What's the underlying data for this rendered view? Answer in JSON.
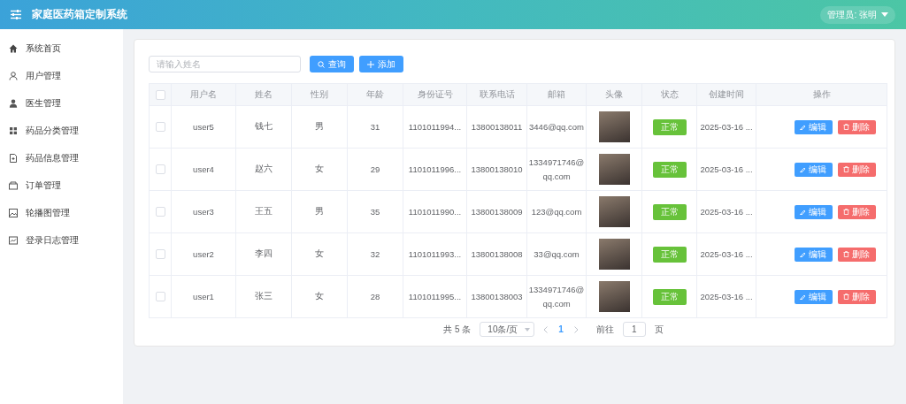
{
  "header": {
    "title": "家庭医药箱定制系统",
    "user": "管理员: 张明"
  },
  "sidebar": {
    "items": [
      {
        "label": "系统首页",
        "selected": false
      },
      {
        "label": "用户管理",
        "selected": false
      },
      {
        "label": "医生管理",
        "selected": false
      },
      {
        "label": "药品分类管理",
        "selected": false
      },
      {
        "label": "药品信息管理",
        "selected": false
      },
      {
        "label": "订单管理",
        "selected": false
      },
      {
        "label": "轮播图管理",
        "selected": false
      },
      {
        "label": "登录日志管理",
        "selected": false
      }
    ]
  },
  "toolbar": {
    "search": {
      "placeholder": "请输入姓名"
    },
    "query_button": "查询",
    "add_button": "添加"
  },
  "table": {
    "all_checked": false,
    "columns": [
      "用户名",
      "姓名",
      "性别",
      "年龄",
      "身份证号",
      "联系电话",
      "邮箱",
      "头像",
      "状态",
      "创建时间",
      "操作"
    ],
    "rows": [
      {
        "checked": false,
        "username": "user5",
        "name": "钱七",
        "gender": "男",
        "age": "31",
        "id_number": "1101011994...",
        "phone": "13800138011",
        "email": "3446@qq.com",
        "status": "正常",
        "created": "2025-03-16 ...",
        "edit": "编辑",
        "delete": "删除"
      },
      {
        "checked": false,
        "username": "user4",
        "name": "赵六",
        "gender": "女",
        "age": "29",
        "id_number": "1101011996...",
        "phone": "13800138010",
        "email": "1334971746@qq.com",
        "status": "正常",
        "created": "2025-03-16 ...",
        "edit": "编辑",
        "delete": "删除"
      },
      {
        "checked": false,
        "username": "user3",
        "name": "王五",
        "gender": "男",
        "age": "35",
        "id_number": "1101011990...",
        "phone": "13800138009",
        "email": "123@qq.com",
        "status": "正常",
        "created": "2025-03-16 ...",
        "edit": "编辑",
        "delete": "删除"
      },
      {
        "checked": false,
        "username": "user2",
        "name": "李四",
        "gender": "女",
        "age": "32",
        "id_number": "1101011993...",
        "phone": "13800138008",
        "email": "33@qq.com",
        "status": "正常",
        "created": "2025-03-16 ...",
        "edit": "编辑",
        "delete": "删除"
      },
      {
        "checked": false,
        "username": "user1",
        "name": "张三",
        "gender": "女",
        "age": "28",
        "id_number": "1101011995...",
        "phone": "13800138003",
        "email": "1334971746@qq.com",
        "status": "正常",
        "created": "2025-03-16 ...",
        "edit": "编辑",
        "delete": "删除"
      }
    ]
  },
  "pagination": {
    "total": "共 5 条",
    "page_size": "10条/页",
    "pages": [
      {
        "label": "1",
        "selected": true
      }
    ],
    "goto_label": "前往",
    "goto_value": "1",
    "goto_suffix": "页"
  }
}
